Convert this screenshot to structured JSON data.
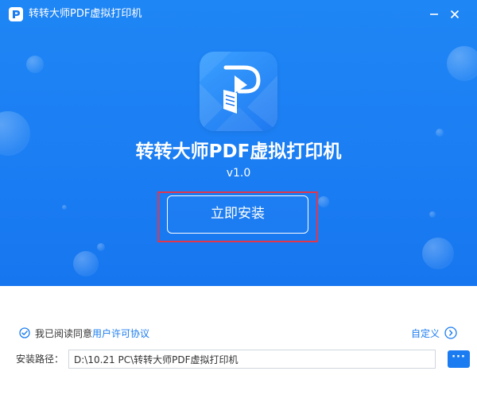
{
  "window": {
    "title": "转转大师PDF虚拟打印机",
    "minimize_glyph": "—",
    "close_glyph": "✕"
  },
  "hero": {
    "app_name": "转转大师PDF虚拟打印机",
    "version": "v1.0",
    "install_label": "立即安装",
    "logo_icon": "printer-p-logo-icon"
  },
  "agreement": {
    "checked": true,
    "prefix_text": "我已阅读同意",
    "link_text": "用户许可协议"
  },
  "custom": {
    "label": "自定义"
  },
  "install_path": {
    "label": "安装路径：",
    "value": "D:\\10.21 PC\\转转大师PDF虚拟打印机",
    "browse_glyph": "···"
  },
  "colors": {
    "brand_blue": "#1b7cf1",
    "highlight_red": "#e0374d"
  }
}
